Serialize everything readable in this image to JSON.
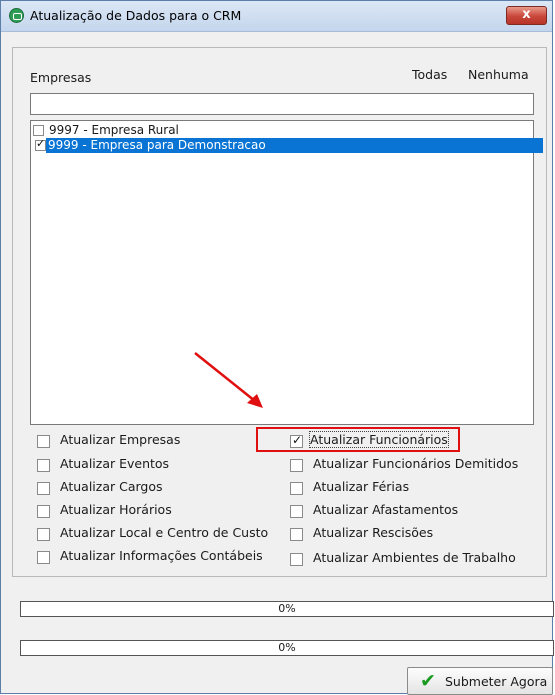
{
  "window": {
    "title": "Atualização de Dados para o CRM",
    "close_label": "x"
  },
  "empresas": {
    "label": "Empresas",
    "todas_label": "Todas",
    "nenhuma_label": "Nenhuma",
    "search_value": "",
    "items": [
      {
        "label": "9997 - Empresa Rural",
        "checked": false,
        "selected": false
      },
      {
        "label": "9999 - Empresa para Demonstracao",
        "checked": true,
        "selected": true
      }
    ]
  },
  "options": {
    "left": [
      {
        "label": "Atualizar Empresas",
        "checked": false
      },
      {
        "label": "Atualizar Eventos",
        "checked": false
      },
      {
        "label": "Atualizar Cargos",
        "checked": false
      },
      {
        "label": "Atualizar Horários",
        "checked": false
      },
      {
        "label": "Atualizar Local e Centro de Custo",
        "checked": false
      },
      {
        "label": "Atualizar Informações Contábeis",
        "checked": false
      }
    ],
    "right": [
      {
        "label": "Atualizar Funcionários",
        "checked": true
      },
      {
        "label": "Atualizar Funcionários Demitidos",
        "checked": false
      },
      {
        "label": "Atualizar Férias",
        "checked": false
      },
      {
        "label": "Atualizar Afastamentos",
        "checked": false
      },
      {
        "label": "Atualizar Rescisões",
        "checked": false
      },
      {
        "label": "Atualizar Ambientes de Trabalho",
        "checked": false
      }
    ]
  },
  "progress": [
    {
      "text": "0%",
      "value": 0
    },
    {
      "text": "0%",
      "value": 0
    }
  ],
  "submit_label": "Submeter Agora",
  "colors": {
    "selection": "#0a74d4",
    "highlight": "#e01010",
    "submit_icon": "#1b9a22"
  }
}
